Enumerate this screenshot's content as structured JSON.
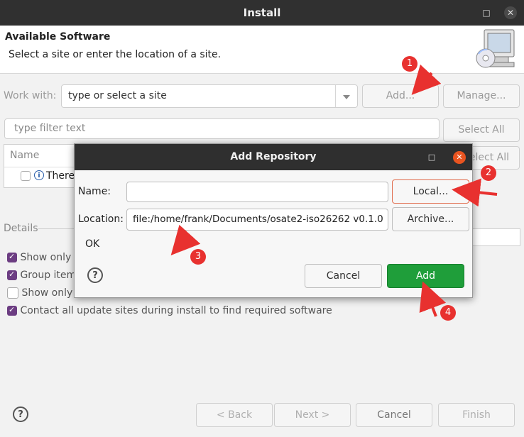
{
  "window": {
    "title": "Install",
    "minimize_glyph": "□",
    "close_glyph": "✕"
  },
  "header": {
    "title": "Available Software",
    "description": "Select a site or enter the location of a site."
  },
  "work_with": {
    "label": "Work with:",
    "value": "type or select a site",
    "add_label": "Add...",
    "manage_label": "Manage..."
  },
  "filter": {
    "placeholder": "type filter text",
    "select_all": "Select All",
    "deselect_all_partial": "elect All"
  },
  "table": {
    "column_name": "Name",
    "row_text_partial": "There"
  },
  "details": {
    "label": "Details"
  },
  "options": [
    {
      "label": "Show only t",
      "checked": true
    },
    {
      "label": "Group item",
      "checked": true
    },
    {
      "label": "Show only s",
      "checked": false
    },
    {
      "label": "Contact all update sites during install to find required software",
      "checked": true
    }
  ],
  "footer": {
    "back": "< Back",
    "next": "Next >",
    "cancel": "Cancel",
    "finish": "Finish",
    "help_glyph": "?"
  },
  "dialog": {
    "title": "Add Repository",
    "close_glyph": "✕",
    "max_glyph": "□",
    "name_label": "Name:",
    "name_value": "",
    "location_label": "Location:",
    "location_value": "file:/home/frank/Documents/osate2-iso26262 v0.1.0",
    "local_label": "Local...",
    "archive_label": "Archive...",
    "status": "OK",
    "cancel_label": "Cancel",
    "add_label": "Add",
    "help_glyph": "?"
  },
  "annotations": [
    "1",
    "2",
    "3",
    "4"
  ],
  "colors": {
    "accent_green": "#1f9e3a",
    "marker_red": "#e8312f",
    "titlebar": "#303030",
    "checkbox_purple": "#6c3d82"
  }
}
